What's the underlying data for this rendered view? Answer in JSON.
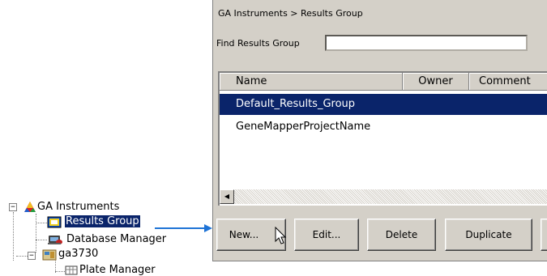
{
  "tree": {
    "root": {
      "label": "GA Instruments",
      "expander": "−"
    },
    "items": [
      {
        "label": "Results Group",
        "selected": true
      },
      {
        "label": "Database Manager"
      },
      {
        "label": "ga3730",
        "expander": "−"
      },
      {
        "label": "Plate Manager"
      }
    ]
  },
  "panel": {
    "breadcrumb": "GA Instruments > Results Group",
    "find": {
      "label": "Find Results Group",
      "value": "",
      "placeholder": ""
    },
    "table": {
      "columns": [
        "Name",
        "Owner",
        "Comment"
      ],
      "rows": [
        {
          "name": "Default_Results_Group",
          "selected": true
        },
        {
          "name": "GeneMapperProjectName"
        }
      ],
      "scroll_left_arrow": "◀"
    },
    "buttons": {
      "new": "New...",
      "edit": "Edit...",
      "delete": "Delete",
      "duplicate": "Duplicate"
    }
  },
  "colors": {
    "selection": "#0a246a",
    "panel": "#d4d0c8",
    "arrow": "#1e73d6"
  },
  "icons": [
    "ga-instruments-icon",
    "results-group-icon",
    "database-manager-icon",
    "instrument-icon",
    "plate-manager-icon",
    "mouse-pointer-icon",
    "callout-arrow-icon"
  ]
}
